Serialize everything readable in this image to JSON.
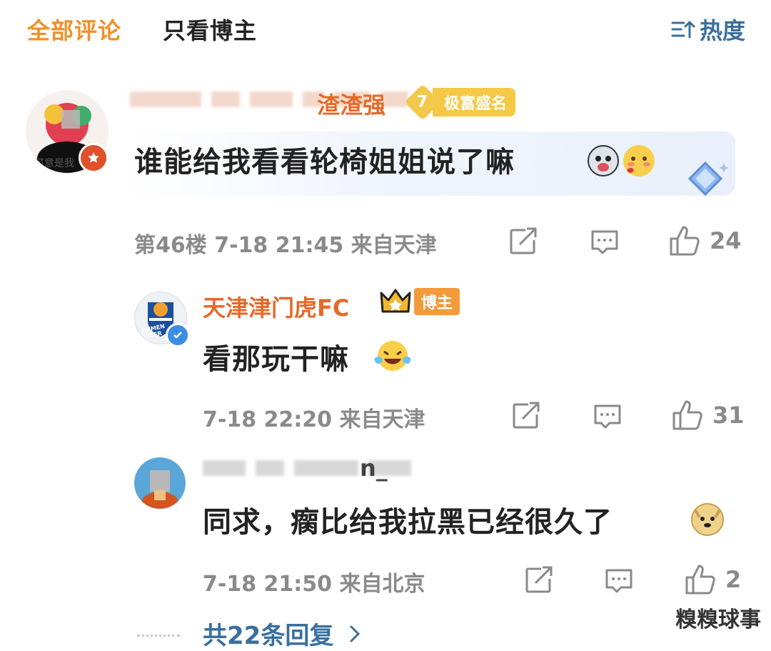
{
  "tabs": {
    "all": "全部评论",
    "blogger_only": "只看博主",
    "sort_label": "热度",
    "sort_icon": "sort-icon"
  },
  "comments": [
    {
      "name_suffix": "渣渣强",
      "fame_level": "7",
      "fame_label": "极富盛名",
      "text": "谁能给我看看轮椅姐姐说了嘛",
      "avatar_caption": "可意是我",
      "floor": "第46楼",
      "time": "7-18 21:45",
      "location": "来自天津",
      "likes": "24"
    },
    {
      "name": "天津津门虎FC",
      "author_tag": "博主",
      "avatar_caption": "JINMEN TIGER",
      "text": "看那玩干嘛",
      "time": "7-18 22:20",
      "location": "来自天津",
      "likes": "31"
    },
    {
      "name_suffix": "n_",
      "text": "同求，瘸比给我拉黑已经很久了",
      "time": "7-18 21:50",
      "location": "来自北京",
      "likes": "2"
    }
  ],
  "footer": {
    "more_replies": "共22条回复",
    "watermark": "糗糗球事"
  },
  "colors": {
    "accent_orange": "#f0902a",
    "name_orange": "#e46a2a",
    "link_blue": "#3a6f9e",
    "meta_gray": "#8a8a8a"
  }
}
